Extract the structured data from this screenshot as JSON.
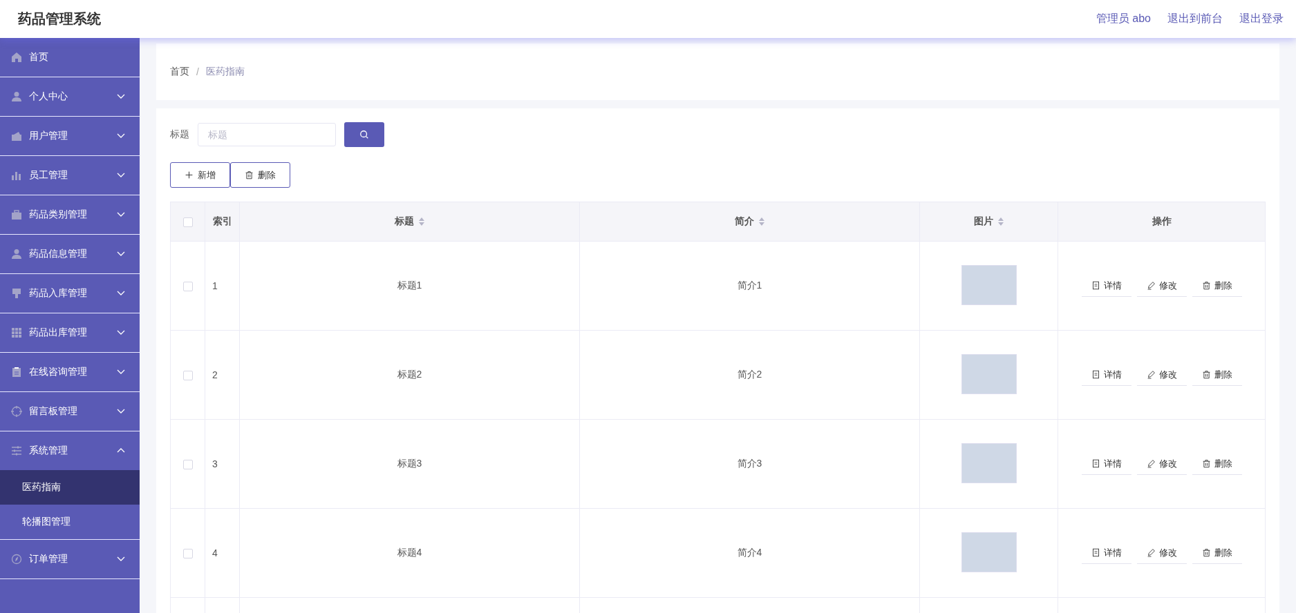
{
  "header": {
    "title": "药品管理系统",
    "links": [
      "管理员 abo",
      "退出到前台",
      "退出登录"
    ]
  },
  "sidebar": {
    "items": [
      {
        "label": "首页",
        "kind": "link"
      },
      {
        "label": "个人中心",
        "kind": "menu",
        "expanded": false
      },
      {
        "label": "用户管理",
        "kind": "menu",
        "expanded": false
      },
      {
        "label": "员工管理",
        "kind": "menu",
        "expanded": false
      },
      {
        "label": "药品类别管理",
        "kind": "menu",
        "expanded": false
      },
      {
        "label": "药品信息管理",
        "kind": "menu",
        "expanded": false
      },
      {
        "label": "药品入库管理",
        "kind": "menu",
        "expanded": false
      },
      {
        "label": "药品出库管理",
        "kind": "menu",
        "expanded": false
      },
      {
        "label": "在线咨询管理",
        "kind": "menu",
        "expanded": false
      },
      {
        "label": "留言板管理",
        "kind": "menu",
        "expanded": false
      },
      {
        "label": "系统管理",
        "kind": "menu",
        "expanded": true,
        "children": [
          {
            "label": "医药指南",
            "selected": true
          },
          {
            "label": "轮播图管理",
            "selected": false
          }
        ]
      },
      {
        "label": "订单管理",
        "kind": "menu",
        "expanded": false
      }
    ]
  },
  "breadcrumb": {
    "items": [
      "首页",
      "医药指南"
    ],
    "separator": "/"
  },
  "search": {
    "label": "标题",
    "placeholder": "标题"
  },
  "toolbar": [
    {
      "label": "新增",
      "kind": "add"
    },
    {
      "label": "删除",
      "kind": "delete"
    }
  ],
  "table": {
    "select_all_checked": false,
    "columns": [
      {
        "label": "索引",
        "sortable": false
      },
      {
        "label": "标题",
        "sortable": true
      },
      {
        "label": "简介",
        "sortable": true
      },
      {
        "label": "图片",
        "sortable": true
      },
      {
        "label": "操作",
        "sortable": false
      }
    ],
    "rows": [
      {
        "checked": false,
        "index": "1",
        "title": "标题1",
        "intro": "简介1",
        "actions": [
          {
            "label": "详情",
            "kind": "detail"
          },
          {
            "label": "修改",
            "kind": "edit"
          },
          {
            "label": "删除",
            "kind": "delete"
          }
        ]
      },
      {
        "checked": false,
        "index": "2",
        "title": "标题2",
        "intro": "简介2",
        "actions": [
          {
            "label": "详情",
            "kind": "detail"
          },
          {
            "label": "修改",
            "kind": "edit"
          },
          {
            "label": "删除",
            "kind": "delete"
          }
        ]
      },
      {
        "checked": false,
        "index": "3",
        "title": "标题3",
        "intro": "简介3",
        "actions": [
          {
            "label": "详情",
            "kind": "detail"
          },
          {
            "label": "修改",
            "kind": "edit"
          },
          {
            "label": "删除",
            "kind": "delete"
          }
        ]
      },
      {
        "checked": false,
        "index": "4",
        "title": "标题4",
        "intro": "简介4",
        "actions": [
          {
            "label": "详情",
            "kind": "detail"
          },
          {
            "label": "修改",
            "kind": "edit"
          },
          {
            "label": "删除",
            "kind": "delete"
          }
        ]
      }
    ]
  }
}
